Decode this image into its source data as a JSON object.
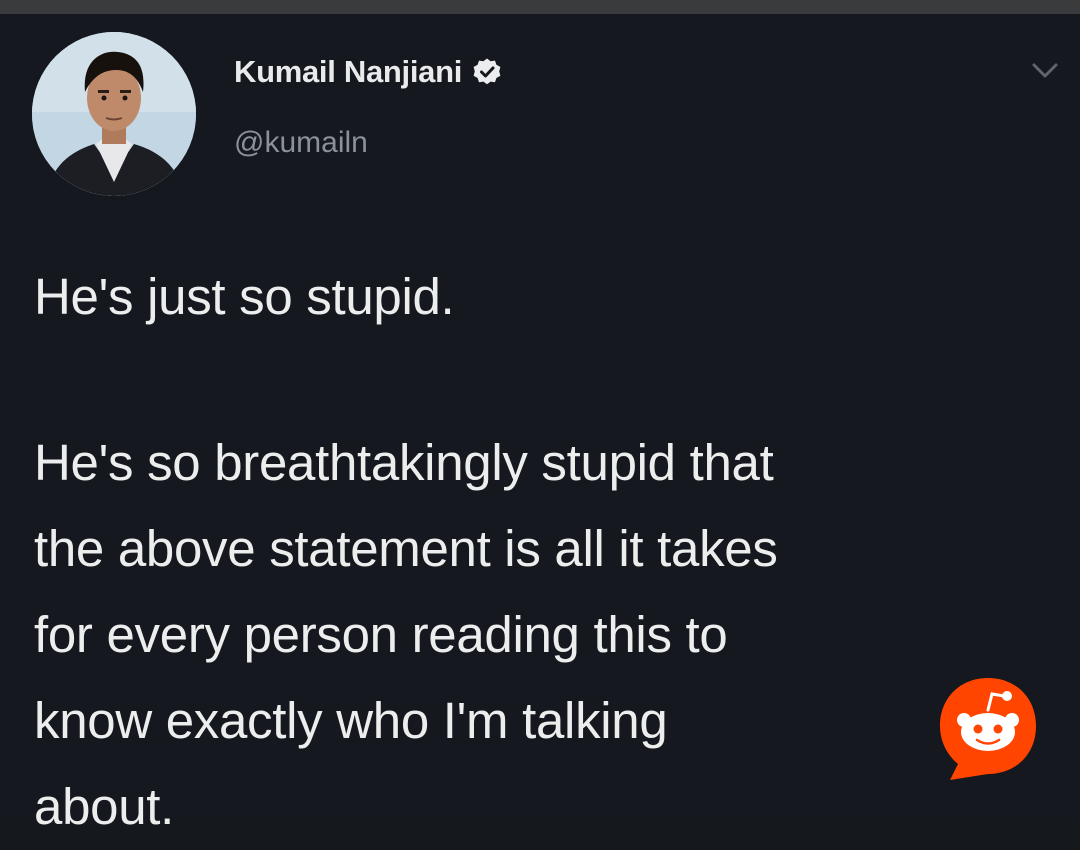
{
  "tweet": {
    "author": {
      "display_name": "Kumail Nanjiani",
      "handle": "@kumailn",
      "verified": true
    },
    "text": {
      "paragraph_1": "He's just so stupid.",
      "paragraph_2_lines": [
        "He's so breathtakingly stupid that",
        "the above statement is all it takes",
        "for every person reading this to",
        "know exactly who I'm talking",
        "about."
      ]
    },
    "icons": {
      "verified": "verified-badge-icon",
      "menu": "chevron-down-icon",
      "watermark": "reddit-logo-icon"
    },
    "colors": {
      "background": "#15181e",
      "text": "#eceded",
      "handle": "#8a9199",
      "reddit_orange": "#ff4500"
    }
  }
}
